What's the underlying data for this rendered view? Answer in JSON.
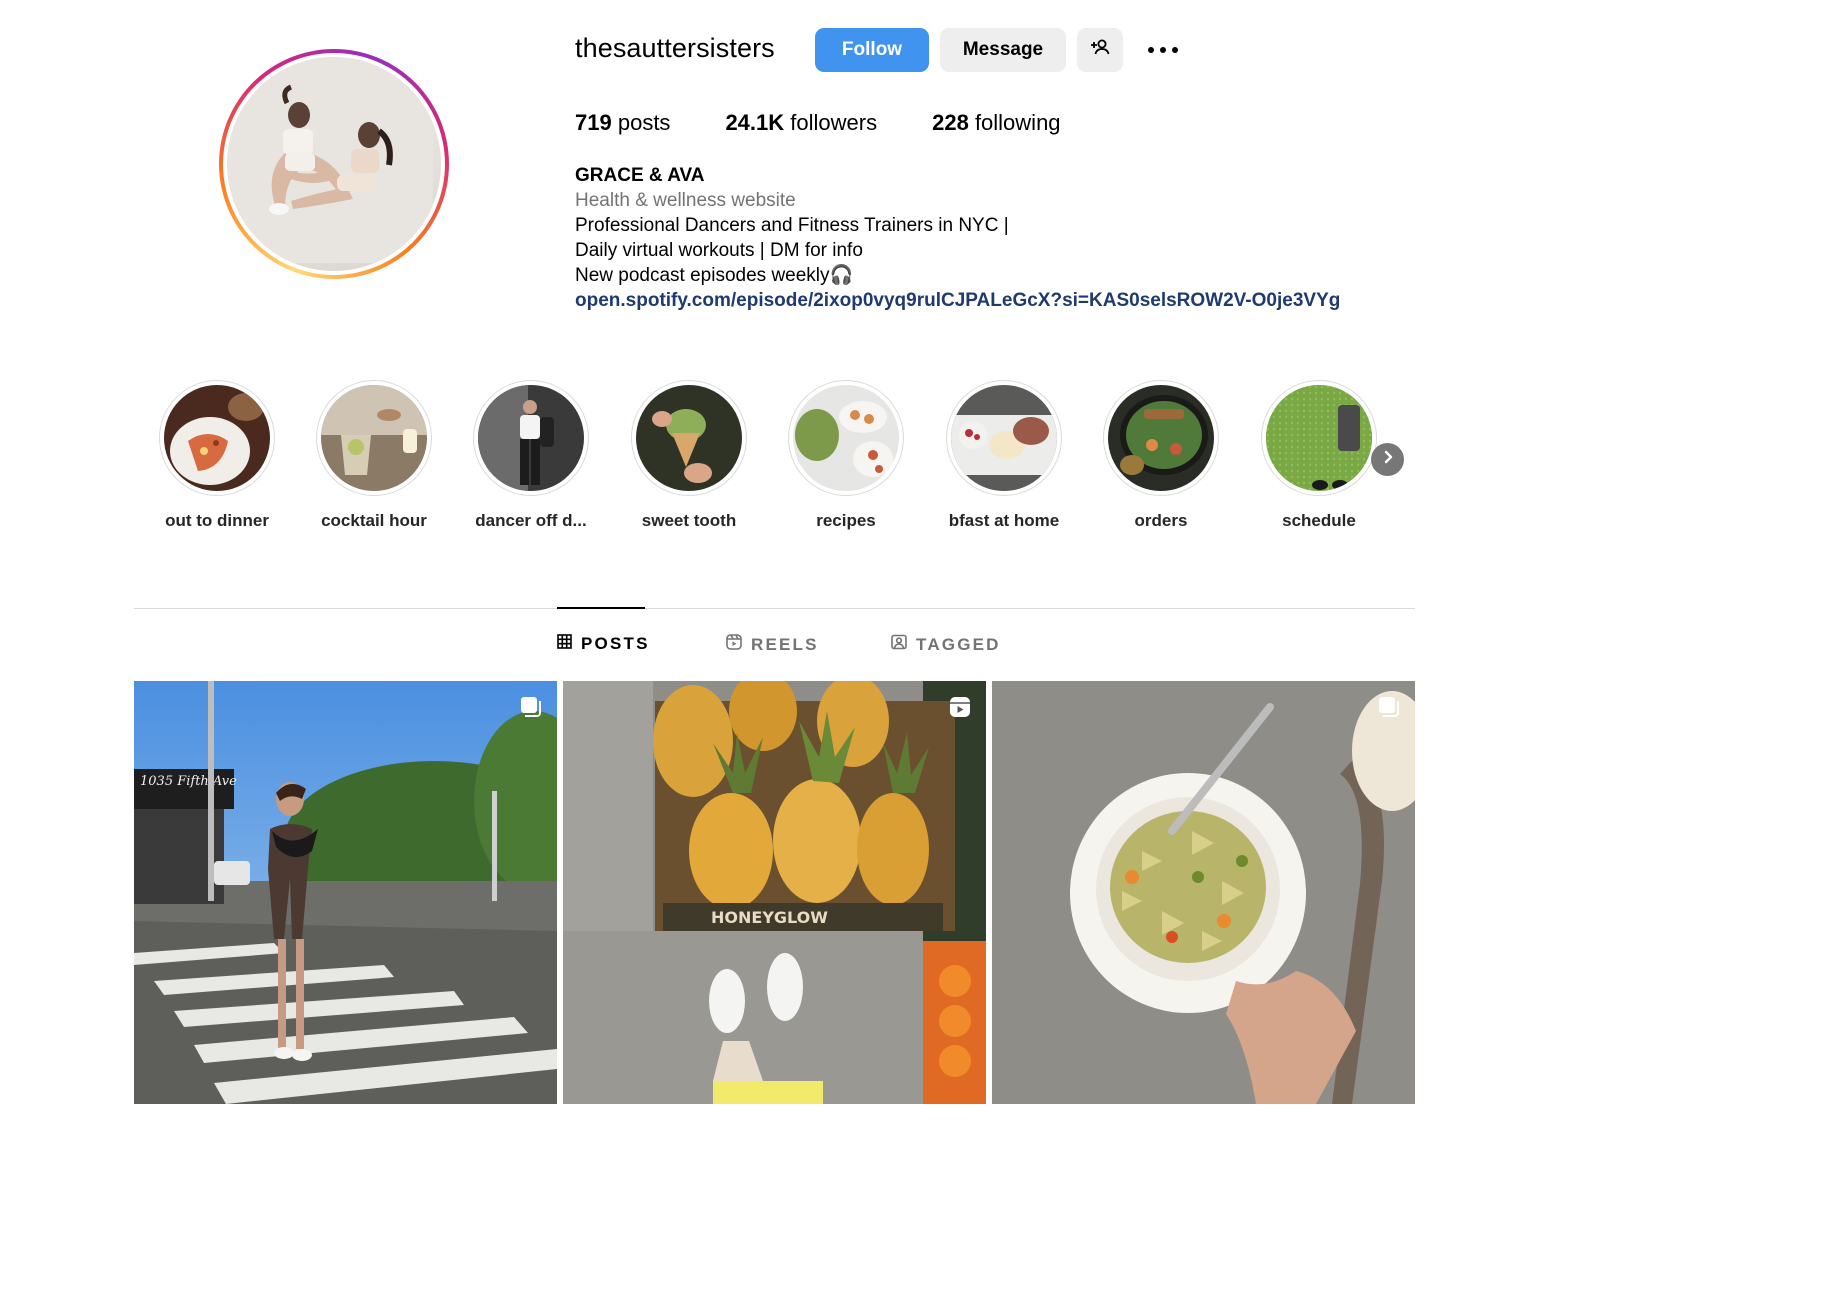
{
  "profile": {
    "username": "thesauttersisters",
    "follow_label": "Follow",
    "message_label": "Message",
    "stats": {
      "posts_count": "719",
      "posts_label": "posts",
      "followers_count": "24.1K",
      "followers_label": "followers",
      "following_count": "228",
      "following_label": "following"
    },
    "bio": {
      "name": "GRACE & AVA",
      "category": "Health & wellness website",
      "line1": "Professional Dancers and Fitness Trainers in NYC |",
      "line2": "Daily virtual workouts | DM for info",
      "line3": "New podcast episodes weekly🎧",
      "link": "open.spotify.com/episode/2ixop0vyq9rulCJPALeGcX?si=KAS0selsROW2V-O0je3VYg"
    }
  },
  "highlights": [
    {
      "label": "out to dinner",
      "icon": "pizza-photo"
    },
    {
      "label": "cocktail hour",
      "icon": "drinks-photo"
    },
    {
      "label": "dancer off d...",
      "icon": "outfit-photo"
    },
    {
      "label": "sweet tooth",
      "icon": "icecream-photo"
    },
    {
      "label": "recipes",
      "icon": "food-plates-photo"
    },
    {
      "label": "bfast at home",
      "icon": "breakfast-photo"
    },
    {
      "label": "orders",
      "icon": "salad-photo"
    },
    {
      "label": "schedule",
      "icon": "grass-photo"
    }
  ],
  "tabs": [
    {
      "label": "POSTS",
      "icon": "grid-icon",
      "active": true
    },
    {
      "label": "REELS",
      "icon": "reels-icon",
      "active": false
    },
    {
      "label": "TAGGED",
      "icon": "tagged-icon",
      "active": false
    }
  ],
  "posts": [
    {
      "type": "carousel",
      "badge_icon": "carousel-icon",
      "image_text": "1035 Fifth Ave"
    },
    {
      "type": "reel",
      "badge_icon": "reel-icon",
      "image_text": "HONEYGLOW"
    },
    {
      "type": "carousel",
      "badge_icon": "carousel-icon"
    }
  ],
  "colors": {
    "follow_button": "#4094ef",
    "secondary_button": "#eeeeee",
    "link": "#1e3a6e",
    "muted_text": "#737373"
  }
}
